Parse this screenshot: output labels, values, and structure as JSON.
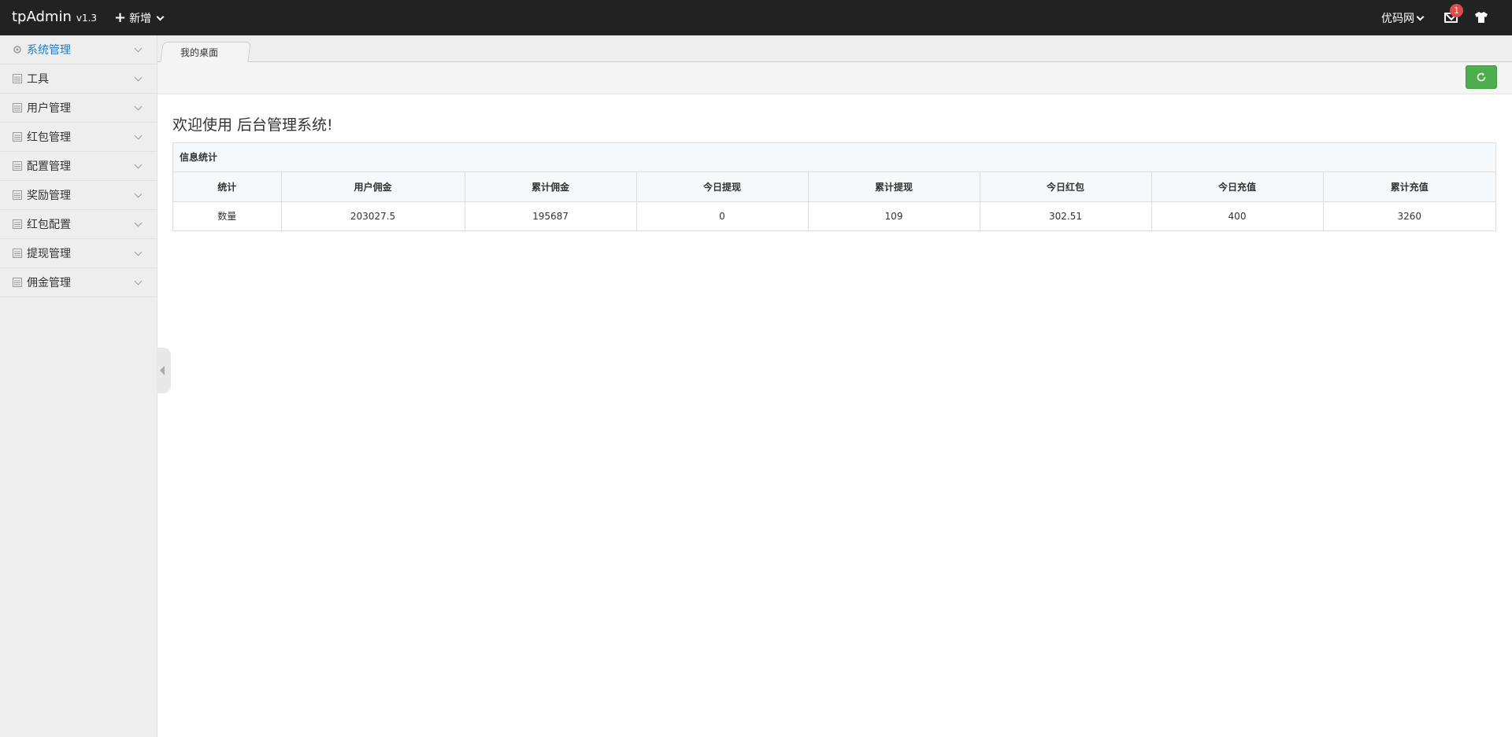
{
  "topbar": {
    "logo": "tpAdmin",
    "version": "v1.3",
    "new_label": "新增",
    "site_label": "优码网",
    "badge_count": "1"
  },
  "sidebar": {
    "items": [
      {
        "label": "系统管理",
        "icon": "gear-icon"
      },
      {
        "label": "工具",
        "icon": "list-icon"
      },
      {
        "label": "用户管理",
        "icon": "list-icon"
      },
      {
        "label": "红包管理",
        "icon": "list-icon"
      },
      {
        "label": "配置管理",
        "icon": "list-icon"
      },
      {
        "label": "奖励管理",
        "icon": "list-icon"
      },
      {
        "label": "红包配置",
        "icon": "list-icon"
      },
      {
        "label": "提现管理",
        "icon": "list-icon"
      },
      {
        "label": "佣金管理",
        "icon": "list-icon"
      }
    ],
    "active_color": "#1e7ccc"
  },
  "tabs": [
    {
      "label": "我的桌面"
    }
  ],
  "toolbar": {
    "refresh_icon": "refresh-icon",
    "refresh_color": "#4cae4c"
  },
  "main": {
    "welcome": "欢迎使用 后台管理系统!",
    "panel_title": "信息统计",
    "table": {
      "headers": [
        "统计",
        "用户佣金",
        "累计佣金",
        "今日提现",
        "累计提现",
        "今日红包",
        "今日充值",
        "累计充值"
      ],
      "rows": [
        [
          "数量",
          "203027.5",
          "195687",
          "0",
          "109",
          "302.51",
          "400",
          "3260"
        ]
      ]
    }
  }
}
